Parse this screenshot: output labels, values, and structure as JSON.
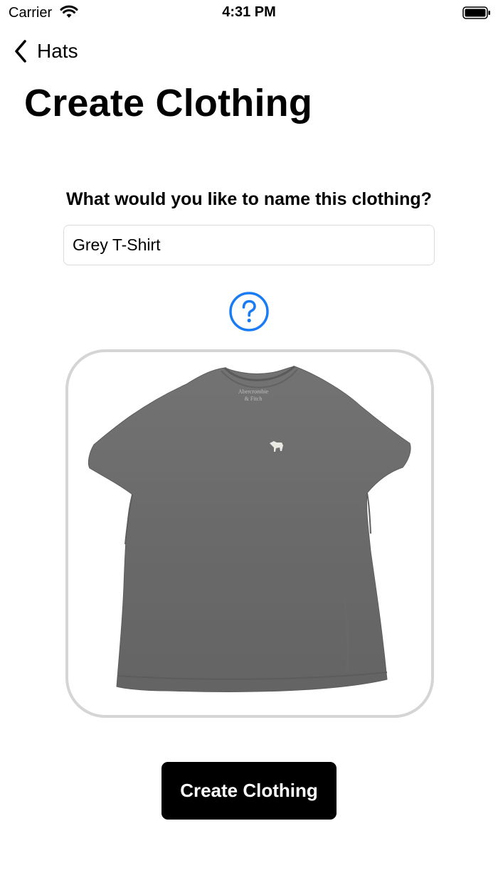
{
  "status_bar": {
    "carrier": "Carrier",
    "time": "4:31 PM"
  },
  "nav": {
    "back_label": "Hats"
  },
  "page": {
    "title": "Create Clothing"
  },
  "form": {
    "question": "What would you like to name this clothing?",
    "name_value": "Grey T-Shirt",
    "help_icon": "question-circle-icon"
  },
  "image": {
    "subject": "grey-tshirt-photo",
    "shirt_color": "#6f6f6f"
  },
  "actions": {
    "create_label": "Create Clothing"
  },
  "colors": {
    "accent": "#1a7cf5",
    "frame_border": "#d5d5d5",
    "button_bg": "#000000"
  }
}
